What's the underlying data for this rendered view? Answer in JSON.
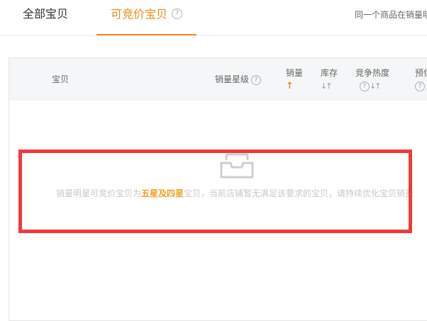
{
  "tabs": {
    "all_label": "全部宝贝",
    "bid_label": "可竞价宝贝",
    "help_glyph": "?",
    "note": "同一个商品在销量明"
  },
  "table": {
    "headers": {
      "baobei": "宝贝",
      "sales_star": "销量星级",
      "sales": "销量",
      "stock": "库存",
      "heat": "竞争热度",
      "pred": "预估"
    },
    "sort_up_glyph": "↑",
    "sort_both_glyph": "↓↑"
  },
  "empty_state": {
    "prefix": "销量明星可竞价宝贝为",
    "highlight": "五星及四星",
    "suffix": "宝贝，当前店铺暂无满足该要求的宝贝，请持续优化宝贝销量"
  },
  "colors": {
    "accent": "#f28a1a",
    "highlight": "#f0a020",
    "annotation_red": "#f03a3a"
  }
}
